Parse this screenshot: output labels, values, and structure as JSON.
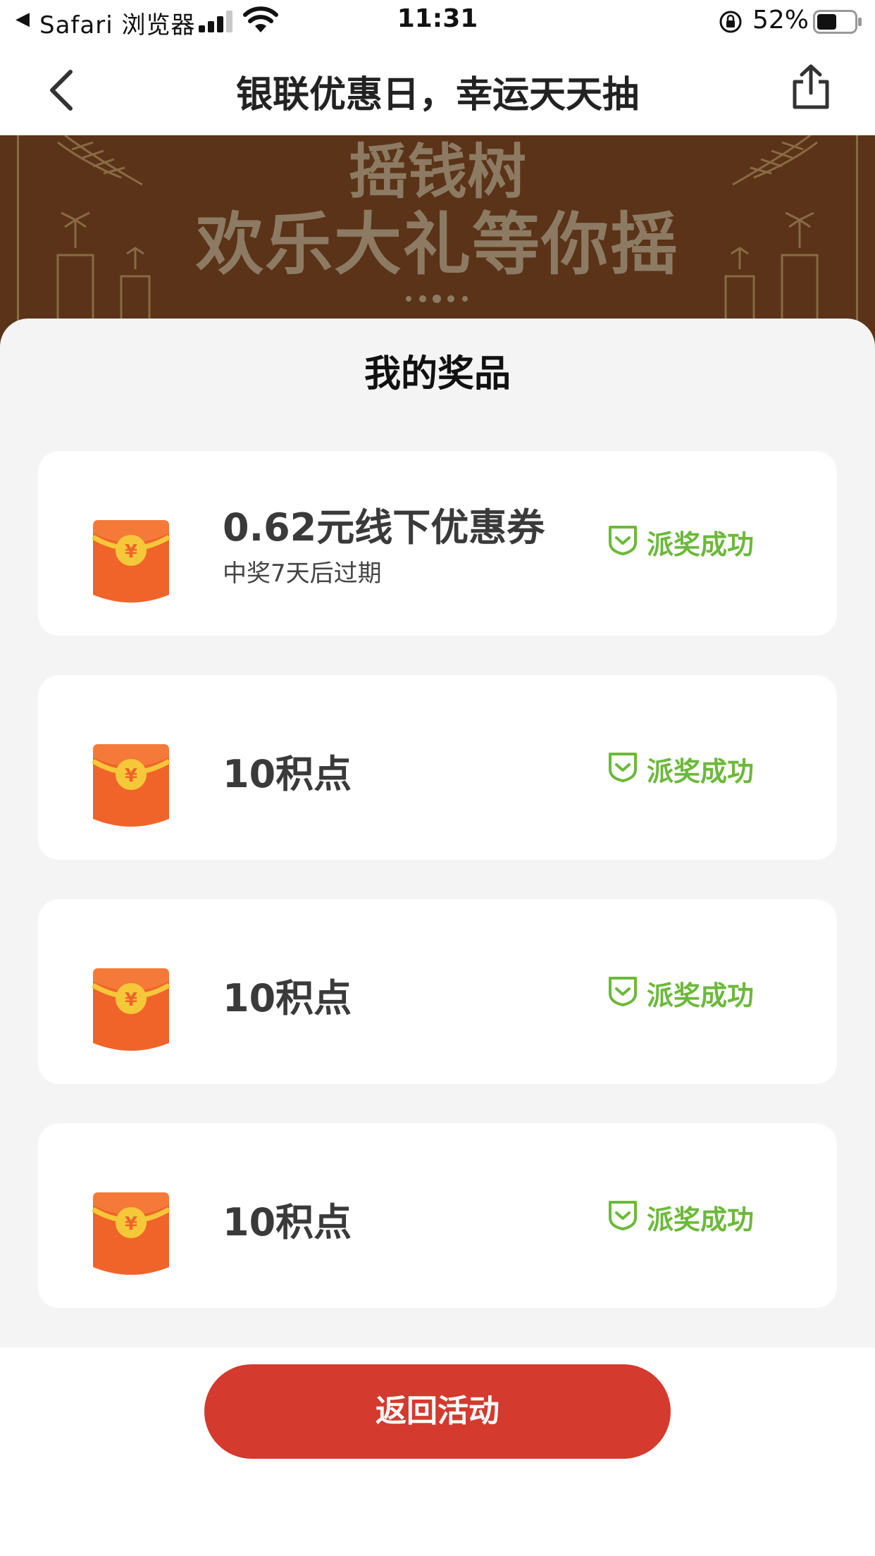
{
  "status_bar": {
    "back_glyph": "◀",
    "app_label": "Safari 浏览器",
    "time": "11:31",
    "battery_percent": "52%",
    "battery_level": 0.52
  },
  "nav": {
    "title": "银联优惠日，幸运天天抽",
    "back_icon": "chevron-left-icon",
    "share_icon": "share-icon"
  },
  "banner": {
    "line1": "摇钱树",
    "line2": "欢乐大礼等你摇"
  },
  "sheet": {
    "title": "我的奖品"
  },
  "prizes": [
    {
      "name": "0.62元线下优惠券",
      "sub": "中奖7天后过期",
      "status": "派奖成功",
      "icon": "red-envelope-icon"
    },
    {
      "name": "10积点",
      "sub": "",
      "status": "派奖成功",
      "icon": "red-envelope-icon"
    },
    {
      "name": "10积点",
      "sub": "",
      "status": "派奖成功",
      "icon": "red-envelope-icon"
    },
    {
      "name": "10积点",
      "sub": "",
      "status": "派奖成功",
      "icon": "red-envelope-icon"
    }
  ],
  "envelope_symbol": "¥",
  "return_button": "返回活动",
  "colors": {
    "accent_red": "#d43a2e",
    "success_green": "#6cb93a",
    "envelope_orange": "#f0642a",
    "envelope_gold": "#f5c83a",
    "banner_brown": "#5a3318"
  }
}
